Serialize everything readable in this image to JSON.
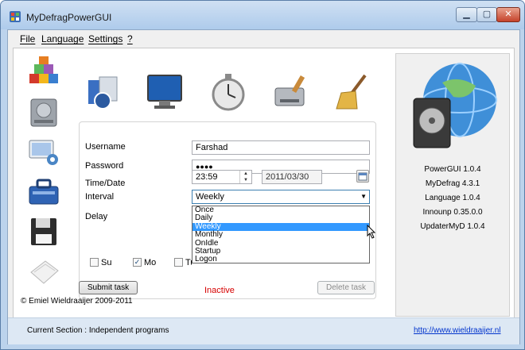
{
  "window": {
    "title": "MyDefragPowerGUI"
  },
  "menu": [
    "File",
    "Language",
    "Settings",
    "?"
  ],
  "sections": {
    "side_icons": [
      "applications-icon",
      "hard-drive-icon",
      "monitor-settings-icon",
      "toolbox-icon",
      "floppy-disk-icon",
      "paper-icon"
    ],
    "top_icons": [
      "software-package-icon",
      "monitor-icon",
      "stopwatch-icon",
      "hard-drive-brush-icon",
      "broom-icon"
    ]
  },
  "form": {
    "username_label": "Username",
    "username_value": "Farshad",
    "password_label": "Password",
    "password_value": "●●●●",
    "time_label": "Time/Date",
    "time_value": "23:59",
    "date_value": "2011/03/30",
    "interval_label": "Interval",
    "interval_value": "Weekly",
    "interval_options": [
      "Once",
      "Daily",
      "Weekly",
      "Monthly",
      "OnIdle",
      "Startup",
      "Logon"
    ],
    "interval_highlighted": "Weekly",
    "delay_label": "Delay",
    "days": [
      {
        "label": "Su",
        "checked": false
      },
      {
        "label": "Mo",
        "checked": true
      },
      {
        "label": "Tu",
        "checked": false
      }
    ],
    "submit_label": "Submit task",
    "status_text": "Inactive",
    "delete_label": "Delete task"
  },
  "info": {
    "versions": [
      "PowerGUI 1.0.4",
      "MyDefrag 4.3.1",
      "Language 1.0.4",
      "Innounp 0.35.0.0",
      "UpdaterMyD 1.0.4"
    ]
  },
  "copyright": "© Emiel Wieldraaijer 2009-2011",
  "statusbar": {
    "section": "Current Section : Independent programs",
    "link": "http://www.wieldraaijer.nl"
  },
  "colors": {
    "titlebar": "#aecbeb",
    "selection": "#3399ff",
    "status_inactive": "#d60000",
    "link": "#0033cc"
  }
}
